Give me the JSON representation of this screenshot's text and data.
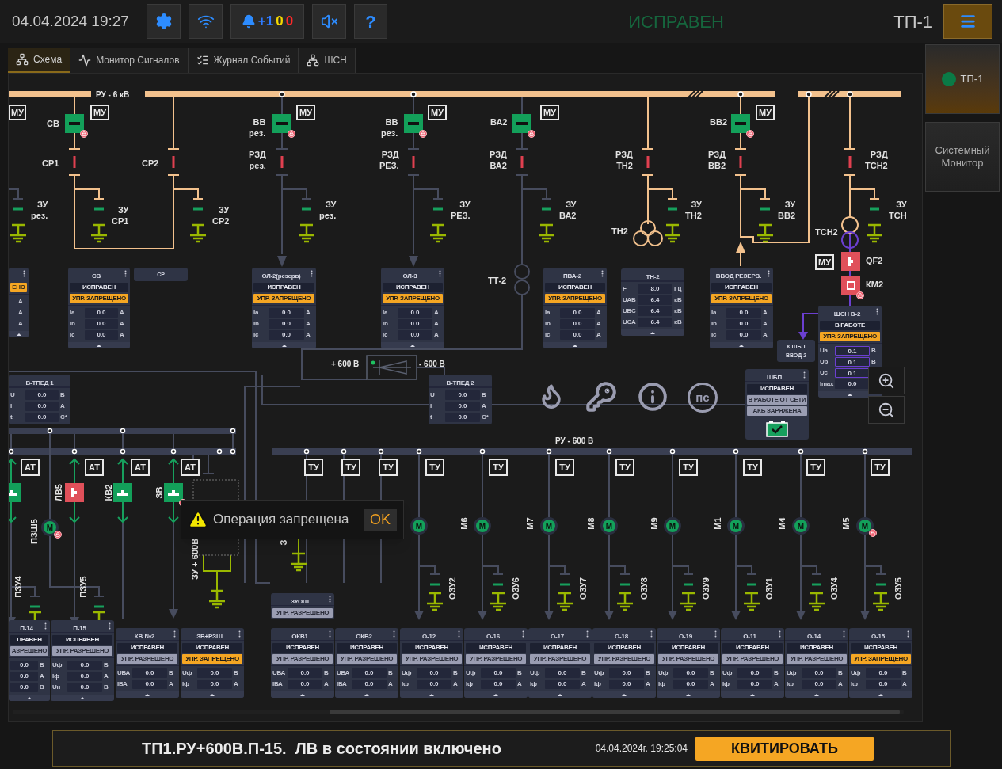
{
  "header": {
    "datetime": "04.04.2024 19:27",
    "alarms": [
      {
        "text": "+1",
        "color": "#2f7bff"
      },
      {
        "text": "0",
        "color": "#f5d800"
      },
      {
        "text": "0",
        "color": "#ff2a2a"
      }
    ],
    "help": "?",
    "status": "ИСПРАВЕН",
    "station": "ТП-1"
  },
  "tabs": [
    {
      "label": "Схема",
      "selected": true
    },
    {
      "label": "Монитор Сигналов",
      "selected": false
    },
    {
      "label": "Журнал Событий",
      "selected": false
    },
    {
      "label": "ШСН",
      "selected": false
    }
  ],
  "sidebar": [
    {
      "label": "ТП-1",
      "selected": true,
      "color": "#0b7a46"
    },
    {
      "label": "Системный Монитор",
      "selected": false
    }
  ],
  "diagram": {
    "bus_labels": [
      "РУ - 6 кВ",
      "+ 600 В",
      "- 600 В",
      "РУ - 600 В"
    ],
    "labels": [
      "СВ",
      "СР1",
      "СР2",
      "ЗУ\nрез.",
      "ЗУ\nСР1",
      "ЗУ\nСР2",
      "ВВ\nрез.",
      "РЗД\nрез.",
      "ЗУ\nрез.",
      "ВВ\nрез.",
      "РЗД\nРЕЗ.",
      "ЗУ\nРЕЗ.",
      "ВА2",
      "РЗД\nВА2",
      "ЗУ\nВА2",
      "РЗД\nТН2",
      "ТН2",
      "ЗУ\nТН2",
      "ВВ2",
      "РЗД\nВВ2",
      "ЗУ\nВВ2",
      "РЗД\nТСН2",
      "ЗУ\nТСН",
      "ТСН2",
      "QF2",
      "КМ2",
      "ТТ-2"
    ],
    "vertical_labels": [
      "ПЗШ5",
      "ЛВ5",
      "КВ2",
      "ЗВ",
      "ЗУ + 600В",
      "З",
      "ПЗУ4",
      "ПЗУ5",
      "М6",
      "М7",
      "М8",
      "М9",
      "М1",
      "М4",
      "М5",
      "ОЗУ2",
      "ОЗУ6",
      "ОЗУ7",
      "ОЗУ8",
      "ОЗУ9",
      "ОЗУ1",
      "ОЗУ4",
      "ОЗУ5"
    ],
    "mu_tags": [
      "МУ",
      "МУ",
      "МУ",
      "МУ",
      "МУ",
      "МУ",
      "МУ"
    ],
    "at_tags": [
      "АТ",
      "АТ",
      "АТ",
      "АТ"
    ],
    "tu_tags": [
      "ТУ",
      "ТУ",
      "ТУ",
      "ТУ",
      "ТУ",
      "ТУ",
      "ТУ",
      "ТУ",
      "ТУ",
      "ТУ",
      "ТУ"
    ],
    "switches": [
      {
        "kind": "vacuum",
        "on": false,
        "locked": true
      },
      {
        "kind": "vacuum",
        "on": false,
        "locked": true
      },
      {
        "kind": "vacuum",
        "on": false,
        "locked": true
      },
      {
        "kind": "vacuum",
        "on": false,
        "locked": true
      },
      {
        "kind": "vacuum",
        "on": false,
        "locked": true
      },
      {
        "kind": "auto",
        "on": true,
        "locked": false
      },
      {
        "kind": "contactor",
        "on": true,
        "locked": true
      },
      {
        "kind": "auto",
        "on": false,
        "locked": false
      },
      {
        "kind": "auto",
        "on": true,
        "locked": false
      },
      {
        "kind": "auto",
        "on": false,
        "locked": false
      },
      {
        "kind": "auto",
        "on": false,
        "locked": true
      }
    ],
    "motors": [
      {
        "letter": "М",
        "locked": true
      },
      {
        "letter": "М",
        "locked": false
      },
      {
        "letter": "М",
        "locked": false
      },
      {
        "letter": "М",
        "locked": false
      },
      {
        "letter": "М",
        "locked": false
      },
      {
        "letter": "М",
        "locked": false
      },
      {
        "letter": "М",
        "locked": false
      },
      {
        "letter": "М",
        "locked": false
      },
      {
        "letter": "М",
        "locked": true
      }
    ],
    "ps_label": "пс",
    "cards": [
      {
        "kind": "panel",
        "menu": true,
        "collapsible": true,
        "states": [
          {
            "text": "ЕНО",
            "kind": "warning"
          }
        ],
        "rows": [
          {
            "unit": "А"
          },
          {
            "unit": "А"
          },
          {
            "unit": "А"
          }
        ]
      },
      {
        "kind": "panel",
        "title": "СВ",
        "menu": true,
        "collapsible": true,
        "states": [
          {
            "text": "ИСПРАВЕН",
            "kind": "status"
          },
          {
            "text": "УПР. ЗАПРЕЩЕНО",
            "kind": "warning"
          }
        ],
        "rows": [
          {
            "label": "Ia",
            "value": "0.0",
            "unit": "А"
          },
          {
            "label": "Ib",
            "value": "0.0",
            "unit": "А"
          },
          {
            "label": "Ic",
            "value": "0.0",
            "unit": "А"
          }
        ]
      },
      {
        "kind": "label",
        "title": "СР"
      },
      {
        "kind": "panel",
        "title": "ОЛ-2(резерв)",
        "menu": true,
        "collapsible": true,
        "states": [
          {
            "text": "ИСПРАВЕН",
            "kind": "status"
          },
          {
            "text": "УПР. ЗАПРЕЩЕНО",
            "kind": "warning"
          }
        ],
        "rows": [
          {
            "label": "Ia",
            "value": "0.0",
            "unit": "А"
          },
          {
            "label": "Ib",
            "value": "0.0",
            "unit": "А"
          },
          {
            "label": "Ic",
            "value": "0.0",
            "unit": "А"
          }
        ]
      },
      {
        "kind": "panel",
        "title": "ОЛ-3",
        "menu": true,
        "collapsible": true,
        "states": [
          {
            "text": "ИСПРАВЕН",
            "kind": "status"
          },
          {
            "text": "УПР. ЗАПРЕЩЕНО",
            "kind": "warning"
          }
        ],
        "rows": [
          {
            "label": "Ia",
            "value": "0.0",
            "unit": "А"
          },
          {
            "label": "Ib",
            "value": "0.0",
            "unit": "А"
          },
          {
            "label": "Ic",
            "value": "0.0",
            "unit": "А"
          }
        ]
      },
      {
        "kind": "panel",
        "title": "ПВА-2",
        "menu": true,
        "collapsible": true,
        "states": [
          {
            "text": "ИСПРАВЕН",
            "kind": "status"
          },
          {
            "text": "УПР. ЗАПРЕЩЕНО",
            "kind": "warning"
          }
        ],
        "rows": [
          {
            "label": "Ia",
            "value": "0.0",
            "unit": "А"
          },
          {
            "label": "Ib",
            "value": "0.0",
            "unit": "А"
          },
          {
            "label": "Ic",
            "value": "0.0",
            "unit": "А"
          }
        ]
      },
      {
        "kind": "panel",
        "title": "ТН-2",
        "menu": false,
        "collapsible": true,
        "rows": [
          {
            "label": "F",
            "value": "8.0",
            "unit": "Гц"
          },
          {
            "label": "UAB",
            "value": "6.4",
            "unit": "кВ"
          },
          {
            "label": "UBC",
            "value": "6.4",
            "unit": "кВ"
          },
          {
            "label": "UCA",
            "value": "6.4",
            "unit": "кВ"
          }
        ]
      },
      {
        "kind": "panel",
        "title": "ВВОД РЕЗЕРВ.",
        "menu": true,
        "collapsible": true,
        "states": [
          {
            "text": "ИСПРАВЕН",
            "kind": "status"
          },
          {
            "text": "УПР. ЗАПРЕЩЕНО",
            "kind": "warning"
          }
        ],
        "rows": [
          {
            "label": "Ia",
            "value": "0.0",
            "unit": "А"
          },
          {
            "label": "Ib",
            "value": "0.0",
            "unit": "А"
          },
          {
            "label": "Ic",
            "value": "0.0",
            "unit": "А"
          }
        ]
      },
      {
        "kind": "label",
        "title": "К ШБП\nВВОД 2"
      },
      {
        "kind": "panel",
        "title": "ШСН В-2",
        "menu": true,
        "collapsible": true,
        "states": [
          {
            "text": "В РАБОТЕ",
            "kind": "status"
          },
          {
            "text": "УПР. ЗАПРЕЩЕНО",
            "kind": "warning"
          }
        ],
        "rows": [
          {
            "label": "Ua",
            "value": "0.1",
            "unit": "В",
            "alarm": true
          },
          {
            "label": "Ub",
            "value": "0.1",
            "unit": "В",
            "alarm": true
          },
          {
            "label": "Uc",
            "value": "0.1",
            "alarm": true
          },
          {
            "label": "Imax",
            "value": "0.0",
            "alarm": false
          }
        ]
      },
      {
        "kind": "panel",
        "title": "В-ТПЕД 1",
        "menu": false,
        "collapsible": false,
        "rows": [
          {
            "label": "U",
            "value": "0.0",
            "unit": "В"
          },
          {
            "label": "I",
            "value": "0.0",
            "unit": "А"
          },
          {
            "label": "t",
            "value": "0.0",
            "unit": "С*"
          }
        ]
      },
      {
        "kind": "panel",
        "title": "В-ТПЕД 2",
        "menu": false,
        "collapsible": false,
        "rows": [
          {
            "label": "U",
            "value": "0.0",
            "unit": "В"
          },
          {
            "label": "I",
            "value": "0.0",
            "unit": "А"
          },
          {
            "label": "t",
            "value": "0.0",
            "unit": "С*"
          }
        ]
      },
      {
        "kind": "panel",
        "title": "ШБП",
        "menu": true,
        "collapsible": false,
        "battery_charged": true,
        "states": [
          {
            "text": "ИСПРАВЕН",
            "kind": "status"
          },
          {
            "text": "В РАБОТЕ ОТ СЕТИ",
            "kind": "info"
          },
          {
            "text": "АКБ ЗАРЯЖЕНА",
            "kind": "info"
          }
        ]
      },
      {
        "kind": "panel",
        "title": "ЗУОШ",
        "menu": true,
        "collapsible": false,
        "states": [
          {
            "text": "УПР. РАЗРЕШЕНО",
            "kind": "info"
          }
        ]
      },
      {
        "kind": "panel",
        "title": "П-14",
        "menu": true,
        "collapsible": true,
        "states": [
          {
            "text": "ПРАВЕН",
            "kind": "status"
          },
          {
            "text": "АЗРЕШЕНО",
            "kind": "info"
          }
        ],
        "rows": [
          {
            "value": "0.0",
            "unit": "В"
          },
          {
            "value": "0.0",
            "unit": "А"
          },
          {
            "value": "0.0",
            "unit": "В"
          }
        ]
      },
      {
        "kind": "panel",
        "title": "П-15",
        "menu": true,
        "collapsible": true,
        "states": [
          {
            "text": "ИСПРАВЕН",
            "kind": "status"
          },
          {
            "text": "УПР. РАЗРЕШЕНО",
            "kind": "info"
          }
        ],
        "rows": [
          {
            "label": "Uф",
            "value": "0.0",
            "unit": "В"
          },
          {
            "label": "Iф",
            "value": "0.0",
            "unit": "А"
          },
          {
            "label": "Uн",
            "value": "0.0",
            "unit": "В"
          }
        ]
      },
      {
        "kind": "panel",
        "title": "КВ №2",
        "menu": true,
        "collapsible": true,
        "states": [
          {
            "text": "ИСПРАВЕН",
            "kind": "status"
          },
          {
            "text": "УПР. РАЗРЕШЕНО",
            "kind": "info"
          }
        ],
        "rows": [
          {
            "label": "UВА",
            "value": "0.0",
            "unit": "В"
          },
          {
            "label": "IВА",
            "value": "0.0",
            "unit": "А"
          }
        ]
      },
      {
        "kind": "panel",
        "title": "ЗВ+РЗШ",
        "menu": true,
        "collapsible": true,
        "states": [
          {
            "text": "ИСПРАВЕН",
            "kind": "status"
          },
          {
            "text": "УПР. ЗАПРЕЩЕНО",
            "kind": "warning"
          }
        ],
        "rows": [
          {
            "label": "Uф",
            "value": "0.0",
            "unit": "В"
          },
          {
            "label": "Iф",
            "value": "0.0",
            "unit": "А"
          }
        ]
      },
      {
        "kind": "panel",
        "title": "ОКВ1",
        "menu": true,
        "collapsible": true,
        "states": [
          {
            "text": "ИСПРАВЕН",
            "kind": "status"
          },
          {
            "text": "УПР. РАЗРЕШЕНО",
            "kind": "info"
          }
        ],
        "rows": [
          {
            "label": "UВА",
            "value": "0.0",
            "unit": "В"
          },
          {
            "label": "IВА",
            "value": "0.0",
            "unit": "А"
          }
        ]
      },
      {
        "kind": "panel",
        "title": "ОКВ2",
        "menu": true,
        "collapsible": true,
        "states": [
          {
            "text": "ИСПРАВЕН",
            "kind": "status"
          },
          {
            "text": "УПР. РАЗРЕШЕНО",
            "kind": "info"
          }
        ],
        "rows": [
          {
            "label": "UВА",
            "value": "0.0",
            "unit": "В"
          },
          {
            "label": "IВА",
            "value": "0.0",
            "unit": "А"
          }
        ]
      },
      {
        "kind": "panel",
        "title": "О-12",
        "menu": true,
        "collapsible": true,
        "states": [
          {
            "text": "ИСПРАВЕН",
            "kind": "status"
          },
          {
            "text": "УПР. РАЗРЕШЕНО",
            "kind": "info"
          }
        ],
        "rows": [
          {
            "label": "Uф",
            "value": "0.0",
            "unit": "В"
          },
          {
            "label": "Iф",
            "value": "0.0",
            "unit": "А"
          }
        ]
      },
      {
        "kind": "panel",
        "title": "О-16",
        "menu": true,
        "collapsible": true,
        "states": [
          {
            "text": "ИСПРАВЕН",
            "kind": "status"
          },
          {
            "text": "УПР. РАЗРЕШЕНО",
            "kind": "info"
          }
        ],
        "rows": [
          {
            "label": "Uф",
            "value": "0.0",
            "unit": "В"
          },
          {
            "label": "Iф",
            "value": "0.0",
            "unit": "А"
          }
        ]
      },
      {
        "kind": "panel",
        "title": "О-17",
        "menu": true,
        "collapsible": true,
        "states": [
          {
            "text": "ИСПРАВЕН",
            "kind": "status"
          },
          {
            "text": "УПР. РАЗРЕШЕНО",
            "kind": "info"
          }
        ],
        "rows": [
          {
            "label": "Uф",
            "value": "0.0",
            "unit": "В"
          },
          {
            "label": "Iф",
            "value": "0.0",
            "unit": "А"
          }
        ]
      },
      {
        "kind": "panel",
        "title": "О-18",
        "menu": true,
        "collapsible": true,
        "states": [
          {
            "text": "ИСПРАВЕН",
            "kind": "status"
          },
          {
            "text": "УПР. РАЗРЕШЕНО",
            "kind": "info"
          }
        ],
        "rows": [
          {
            "label": "Uф",
            "value": "0.0",
            "unit": "В"
          },
          {
            "label": "Iф",
            "value": "0.0",
            "unit": "А"
          }
        ]
      },
      {
        "kind": "panel",
        "title": "О-19",
        "menu": true,
        "collapsible": true,
        "states": [
          {
            "text": "ИСПРАВЕН",
            "kind": "status"
          },
          {
            "text": "УПР. РАЗРЕШЕНО",
            "kind": "info"
          }
        ],
        "rows": [
          {
            "label": "Uф",
            "value": "0.0",
            "unit": "В"
          },
          {
            "label": "Iф",
            "value": "0.0",
            "unit": "А"
          }
        ]
      },
      {
        "kind": "panel",
        "title": "О-11",
        "menu": true,
        "collapsible": true,
        "states": [
          {
            "text": "ИСПРАВЕН",
            "kind": "status"
          },
          {
            "text": "УПР. РАЗРЕШЕНО",
            "kind": "info"
          }
        ],
        "rows": [
          {
            "label": "Uф",
            "value": "0.0",
            "unit": "В"
          },
          {
            "label": "Iф",
            "value": "0.0",
            "unit": "А"
          }
        ]
      },
      {
        "kind": "panel",
        "title": "О-14",
        "menu": true,
        "collapsible": true,
        "states": [
          {
            "text": "ИСПРАВЕН",
            "kind": "status"
          },
          {
            "text": "УПР. РАЗРЕШЕНО",
            "kind": "info"
          }
        ],
        "rows": [
          {
            "label": "Uф",
            "value": "0.0",
            "unit": "В"
          },
          {
            "label": "Iф",
            "value": "0.0",
            "unit": "А"
          }
        ]
      },
      {
        "kind": "panel",
        "title": "О-15",
        "menu": true,
        "collapsible": true,
        "states": [
          {
            "text": "ИСПРАВЕН",
            "kind": "status"
          },
          {
            "text": "УПР. ЗАПРЕЩЕНО",
            "kind": "warning"
          }
        ],
        "rows": [
          {
            "label": "Uф",
            "value": "0.0",
            "unit": "В"
          },
          {
            "label": "Iф",
            "value": "0.0",
            "unit": "А"
          }
        ]
      }
    ]
  },
  "dialog": {
    "message": "Операция запрещена",
    "button": "OK"
  },
  "alarm_bar": {
    "message": "ТП1.РУ+600В.П-15.  ЛВ в состоянии включено",
    "time": "04.04.2024г. 19:25:04",
    "button": "КВИТИРОВАТЬ"
  }
}
